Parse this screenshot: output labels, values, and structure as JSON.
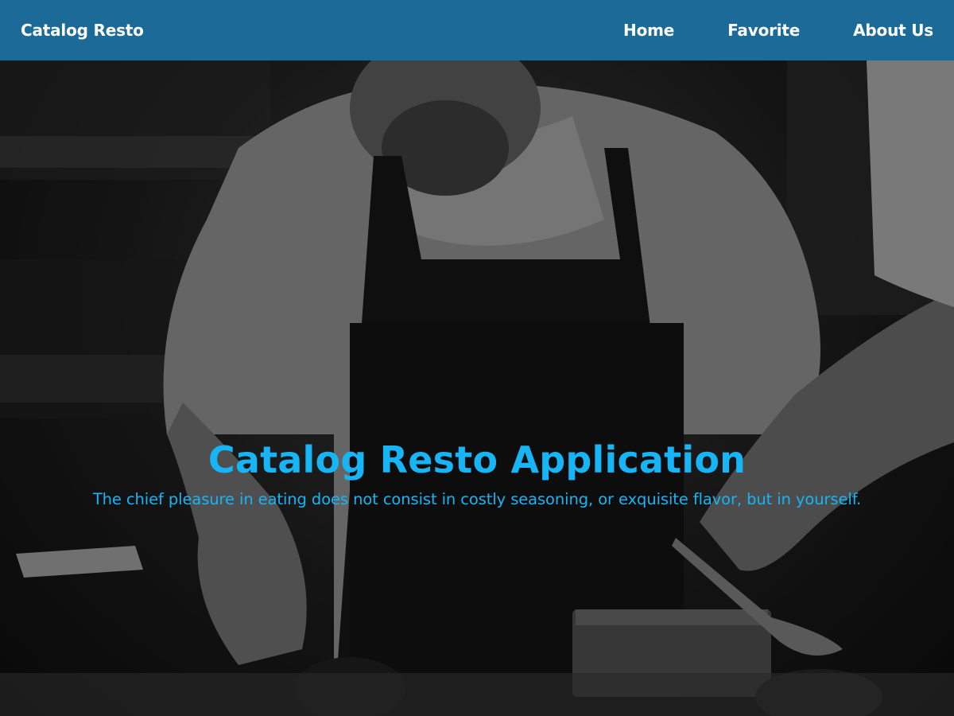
{
  "navbar": {
    "brand": "Catalog Resto",
    "links": [
      {
        "label": "Home"
      },
      {
        "label": "Favorite"
      },
      {
        "label": "About Us"
      }
    ]
  },
  "hero": {
    "title": "Catalog Resto Application",
    "subtitle": "The chief pleasure in eating does not consist in costly seasoning, or exquisite flavor, but in yourself.",
    "image": "chef-plating-food-photo"
  },
  "colors": {
    "navbar_bg": "#1b6a97",
    "nav_text": "#ffffff",
    "hero_text": "#17b5f5"
  }
}
